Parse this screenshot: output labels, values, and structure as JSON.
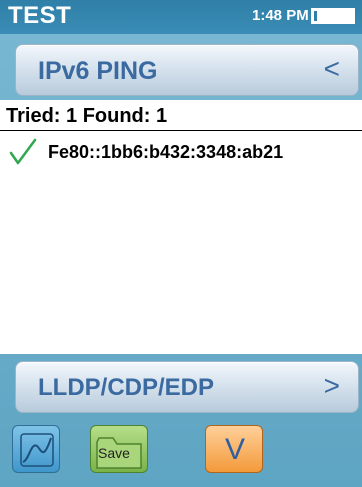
{
  "statusbar": {
    "title": "TEST",
    "time": "1:48 PM",
    "battery_level": 0.08
  },
  "header": {
    "title": "IPv6 PING",
    "back_glyph": "<"
  },
  "results": {
    "summary": "Tried: 1 Found: 1",
    "rows": [
      {
        "status_icon": "check-icon",
        "address": "Fe80::1bb6:b432:3348:ab21"
      }
    ]
  },
  "nav": {
    "label": "LLDP/CDP/EDP",
    "forward_glyph": ">"
  },
  "toolbar": {
    "graph_icon": "graph-icon",
    "save_label": "Save",
    "menu_glyph": "V"
  },
  "colors": {
    "accent_text": "#3a6aa0",
    "status_bar": "#2f7fa8",
    "background": "#6aaec9",
    "check_green": "#2fa84f",
    "save_green": "#79b448",
    "menu_orange": "#f39a3a"
  }
}
